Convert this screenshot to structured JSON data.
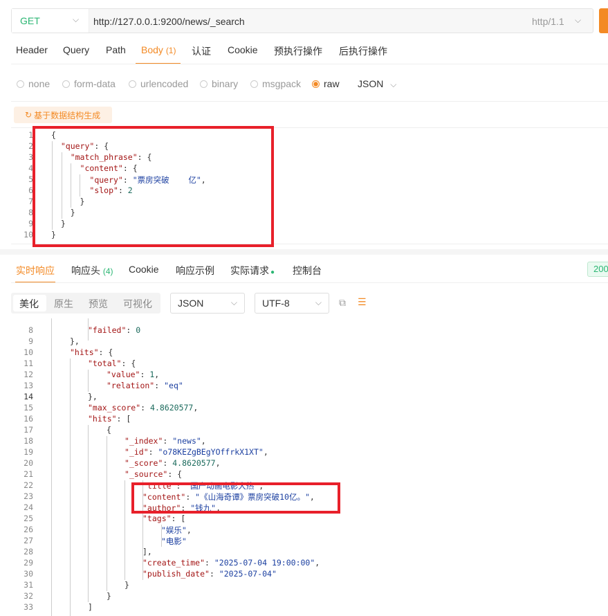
{
  "request": {
    "method": "GET",
    "url": "http://127.0.0.1:9200/news/_search",
    "http_version": "http/1.1",
    "tabs": [
      {
        "label": "Header"
      },
      {
        "label": "Query"
      },
      {
        "label": "Path"
      },
      {
        "label": "Body",
        "count": "(1)"
      },
      {
        "label": "认证"
      },
      {
        "label": "Cookie"
      },
      {
        "label": "预执行操作"
      },
      {
        "label": "后执行操作"
      }
    ],
    "body_types": [
      "none",
      "form-data",
      "urlencoded",
      "binary",
      "msgpack",
      "raw"
    ],
    "body_type_selected": "raw",
    "raw_format": "JSON",
    "gen_button": "基于数据结构生成",
    "body_lines": [
      "1",
      "2",
      "3",
      "4",
      "5",
      "6",
      "7",
      "8",
      "9",
      "10"
    ]
  },
  "response": {
    "tabs": [
      {
        "label": "实时响应"
      },
      {
        "label": "响应头",
        "count": "(4)"
      },
      {
        "label": "Cookie"
      },
      {
        "label": "响应示例"
      },
      {
        "label": "实际请求"
      },
      {
        "label": "控制台"
      }
    ],
    "status": "200",
    "views": [
      "美化",
      "原生",
      "预览",
      "可视化"
    ],
    "format": "JSON",
    "encoding": "UTF-8",
    "line_numbers": [
      "8",
      "9",
      "10",
      "11",
      "12",
      "13",
      "14",
      "15",
      "16",
      "17",
      "18",
      "19",
      "20",
      "21",
      "22",
      "23",
      "24",
      "25",
      "26",
      "27",
      "28",
      "29",
      "30",
      "31",
      "32",
      "33"
    ]
  },
  "colors": {
    "accent": "#f38a25",
    "success": "#2bb673",
    "annotation": "#e8202a"
  }
}
